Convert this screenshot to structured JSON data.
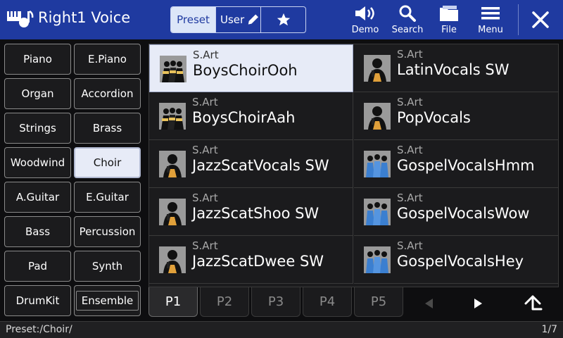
{
  "header": {
    "title": "Right1 Voice",
    "tabs": {
      "preset": "Preset",
      "user": "User"
    },
    "tools": {
      "demo": "Demo",
      "search": "Search",
      "file": "File",
      "menu": "Menu"
    }
  },
  "categories": [
    "Piano",
    "E.Piano",
    "Organ",
    "Accordion",
    "Strings",
    "Brass",
    "Woodwind",
    "Choir",
    "A.Guitar",
    "E.Guitar",
    "Bass",
    "Percussion",
    "Pad",
    "Synth",
    "DrumKit",
    "Ensemble"
  ],
  "selected_category": "Choir",
  "voices": [
    {
      "tag": "S.Art",
      "name": "BoysChoirOoh",
      "icon": "boys-choir-icon",
      "selected": true
    },
    {
      "tag": "S.Art",
      "name": "LatinVocals SW",
      "icon": "singer-icon"
    },
    {
      "tag": "S.Art",
      "name": "BoysChoirAah",
      "icon": "boys-choir-icon"
    },
    {
      "tag": "S.Art",
      "name": "PopVocals",
      "icon": "singer-icon"
    },
    {
      "tag": "S.Art",
      "name": "JazzScatVocals SW",
      "icon": "singer-icon"
    },
    {
      "tag": "S.Art",
      "name": "GospelVocalsHmm",
      "icon": "gospel-choir-icon"
    },
    {
      "tag": "S.Art",
      "name": "JazzScatShoo SW",
      "icon": "singer-icon"
    },
    {
      "tag": "S.Art",
      "name": "GospelVocalsWow",
      "icon": "gospel-choir-icon"
    },
    {
      "tag": "S.Art",
      "name": "JazzScatDwee SW",
      "icon": "singer-icon"
    },
    {
      "tag": "S.Art",
      "name": "GospelVocalsHey",
      "icon": "gospel-choir-icon"
    }
  ],
  "pages": [
    "P1",
    "P2",
    "P3",
    "P4",
    "P5"
  ],
  "active_page": "P1",
  "status": {
    "path": "Preset:/Choir/",
    "page": "1/7"
  },
  "colors": {
    "header": "#1f3aa0",
    "selected": "#e7ebf7",
    "background": "#0e0e10",
    "panel": "#1b1b1d"
  }
}
